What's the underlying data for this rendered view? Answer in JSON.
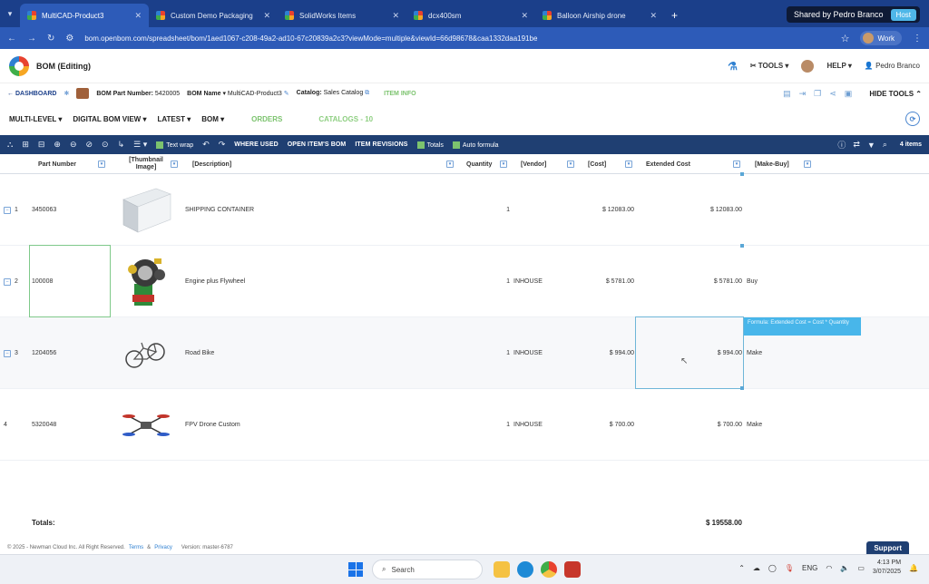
{
  "browser": {
    "tabs": [
      {
        "title": "MultiCAD-Product3",
        "active": true
      },
      {
        "title": "Custom Demo Packaging",
        "active": false
      },
      {
        "title": "SolidWorks Items",
        "active": false
      },
      {
        "title": "dcx400sm",
        "active": false
      },
      {
        "title": "Balloon Airship drone",
        "active": false
      }
    ],
    "shared_label": "Shared by Pedro Branco",
    "host_label": "Host",
    "url": "bom.openbom.com/spreadsheet/bom/1aed1067-c208-49a2-ad10-67c20839a2c3?viewMode=multiple&viewId=66d98678&caa1332daa191be",
    "profile_label": "Work"
  },
  "app": {
    "title": "BOM (Editing)",
    "tools_label": "TOOLS",
    "help_label": "HELP",
    "user_name": "Pedro Branco"
  },
  "crumb": {
    "dashboard": "DASHBOARD",
    "part_number_label": "BOM Part Number:",
    "part_number_value": "5420005",
    "bom_name_label": "BOM Name",
    "bom_name_value": "MultiCAD-Product3",
    "catalog_label": "Catalog:",
    "catalog_value": "Sales Catalog",
    "item_info": "ITEM INFO",
    "hide_tools": "HIDE TOOLS"
  },
  "viewbar": {
    "multi_level": "MULTI-LEVEL",
    "digital_bom_view": "DIGITAL BOM VIEW",
    "latest": "LATEST",
    "bom": "BOM",
    "orders": "ORDERS",
    "catalogs": "CATALOGS - 10"
  },
  "toolbar": {
    "text_wrap": "Text wrap",
    "where_used": "WHERE USED",
    "open_items_bom": "OPEN ITEM'S BOM",
    "item_revisions": "ITEM REVISIONS",
    "totals": "Totals",
    "auto_formula": "Auto formula",
    "items_count": "4 items"
  },
  "columns": {
    "part_number": "Part Number",
    "thumbnail_image": "[Thumbnail Image]",
    "description": "[Description]",
    "quantity": "Quantity",
    "vendor": "[Vendor]",
    "cost": "[Cost]",
    "extended_cost": "Extended Cost",
    "make_buy": "[Make-Buy]"
  },
  "rows": [
    {
      "num": "1",
      "part_number": "3450063",
      "description": "SHIPPING CONTAINER",
      "quantity": "1",
      "vendor": "",
      "cost": "$ 12083.00",
      "extended_cost": "$ 12083.00",
      "make_buy": "",
      "thumb": "container"
    },
    {
      "num": "2",
      "part_number": "100008",
      "description": "Engine plus Flywheel",
      "quantity": "1",
      "vendor": "INHOUSE",
      "cost": "$ 5781.00",
      "extended_cost": "$ 5781.00",
      "make_buy": "Buy",
      "thumb": "engine"
    },
    {
      "num": "3",
      "part_number": "1204056",
      "description": "Road Bike",
      "quantity": "1",
      "vendor": "INHOUSE",
      "cost": "$ 994.00",
      "extended_cost": "$ 994.00",
      "make_buy": "Make",
      "thumb": "bike"
    },
    {
      "num": "4",
      "part_number": "5320048",
      "description": "FPV Drone Custom",
      "quantity": "1",
      "vendor": "INHOUSE",
      "cost": "$ 700.00",
      "extended_cost": "$ 700.00",
      "make_buy": "Make",
      "thumb": "drone"
    }
  ],
  "tooltip": "Formula: Extended Cost = Cost * Quantity",
  "totals": {
    "label": "Totals:",
    "value": "$ 19558.00"
  },
  "footer": {
    "copyright": "© 2025 - Newman Cloud Inc. All Right Reserved.",
    "terms": "Terms",
    "amp": "&",
    "privacy": "Privacy",
    "version": "Version: master-6787",
    "support": "Support"
  },
  "taskbar": {
    "search_placeholder": "Search",
    "lang": "ENG",
    "time": "4:13 PM",
    "date": "3/07/2025"
  },
  "colors": {
    "tab_strip": "#1b3f8a",
    "address_bar": "#2d5bb8",
    "toolbar": "#1f3f72",
    "accent_green": "#7cc36e",
    "selection_blue": "#48b6ea"
  }
}
